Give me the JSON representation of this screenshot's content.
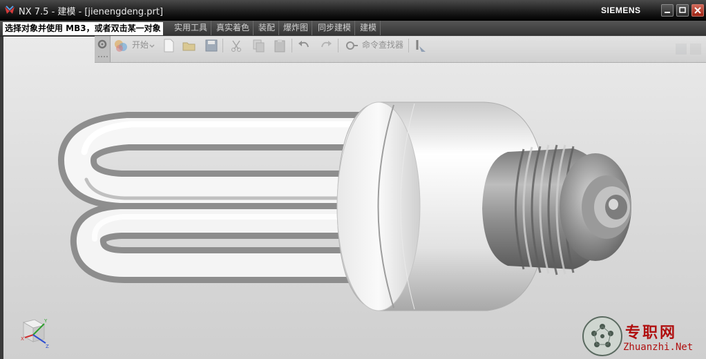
{
  "window": {
    "title": "NX 7.5 - 建模 - [jienengdeng.prt]",
    "brand": "SIEMENS"
  },
  "menubar": {
    "cue_line": "选择对象并使用 MB3，或者双击某一对象",
    "items": [
      {
        "label": "实用工具"
      },
      {
        "label": "真实着色"
      },
      {
        "label": "装配"
      },
      {
        "label": "爆炸图"
      },
      {
        "label": "同步建模"
      },
      {
        "label": "建模"
      }
    ]
  },
  "toolbar": {
    "start_label": "开始",
    "command_finder_label": "命令查找器",
    "icons": [
      "settings-icon",
      "start-icon",
      "new-file-icon",
      "open-folder-icon",
      "save-icon",
      "cut-icon",
      "copy-icon",
      "paste-icon",
      "undo-icon",
      "redo-icon",
      "command-finder-icon",
      "info-icon"
    ]
  },
  "viewport": {
    "triad_axes": [
      "X",
      "Y",
      "Z"
    ]
  },
  "watermark": {
    "text": "专职网",
    "url": "Zhuanzhi.Net"
  },
  "colors": {
    "titlebar": "#1a1a1a",
    "menubar": "#3f3f3f",
    "viewport_bg": "#e0e0e0",
    "watermark": "#b01010"
  }
}
